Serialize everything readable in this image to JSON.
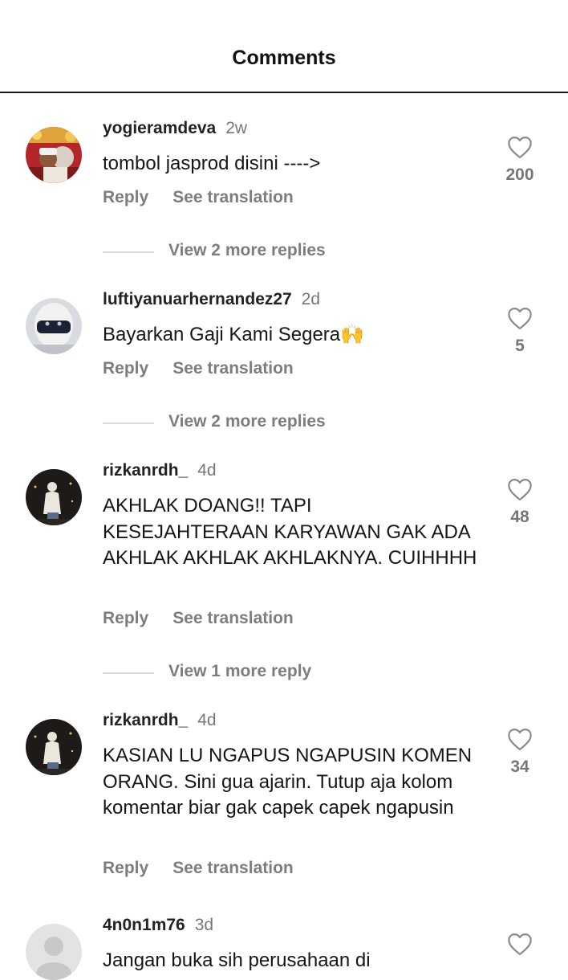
{
  "header": {
    "title": "Comments"
  },
  "labels": {
    "reply": "Reply",
    "see_translation": "See translation"
  },
  "comments": [
    {
      "username": "yogieramdeva",
      "time": "2w",
      "text": "tombol jasprod disini ---->",
      "likes": "200",
      "view_replies": "View 2 more replies"
    },
    {
      "username": "luftiyanuarhernandez27",
      "time": "2d",
      "text": "Bayarkan Gaji Kami Segera🙌",
      "likes": "5",
      "view_replies": "View 2 more replies"
    },
    {
      "username": "rizkanrdh_",
      "time": "4d",
      "text": "AKHLAK DOANG!! TAPI KESEJAHTERAAN KARYAWAN GAK ADA AKHLAK AKHLAK AKHLAKNYA. CUIHHHH",
      "likes": "48",
      "view_replies": "View 1 more reply"
    },
    {
      "username": "rizkanrdh_",
      "time": "4d",
      "text": "KASIAN LU NGAPUS NGAPUSIN KOMEN ORANG. Sini gua ajarin. Tutup aja kolom komentar biar gak capek capek ngapusin",
      "likes": "34"
    },
    {
      "username": "4n0n1m76",
      "time": "3d",
      "text": "Jangan buka sih perusahaan di"
    }
  ]
}
